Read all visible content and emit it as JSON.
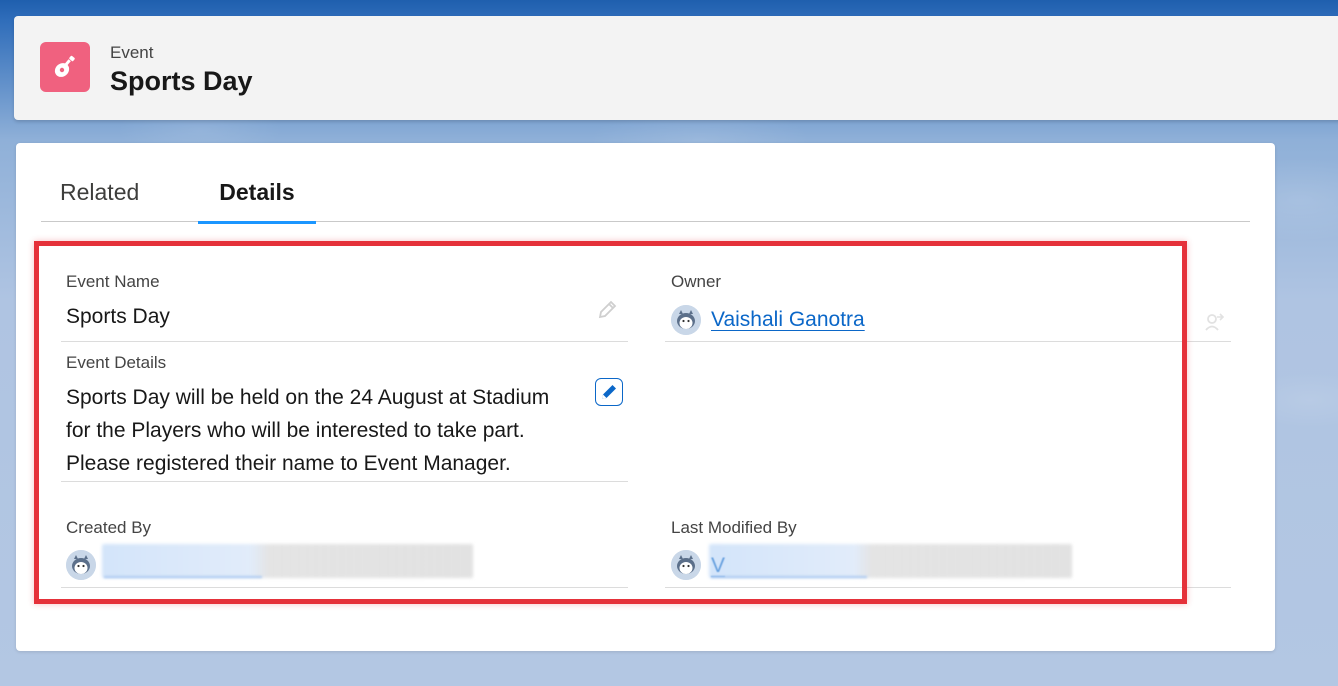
{
  "header": {
    "object_label": "Event",
    "record_title": "Sports Day",
    "icon": "guitar-icon",
    "icon_color": "#f0617f"
  },
  "tabs": [
    {
      "label": "Related",
      "active": false
    },
    {
      "label": "Details",
      "active": true
    }
  ],
  "fields": {
    "event_name": {
      "label": "Event Name",
      "value": "Sports Day"
    },
    "owner": {
      "label": "Owner",
      "value": "Vaishali Ganotra"
    },
    "event_details": {
      "label": "Event Details",
      "lines": [
        "Sports Day will be held on the 24 August at Stadium",
        "for the Players who will be interested to take part.",
        "Please registered their name to Event Manager."
      ]
    },
    "created_by": {
      "label": "Created By"
    },
    "last_modified_by": {
      "label": "Last Modified By",
      "value_initial": "V"
    }
  },
  "colors": {
    "highlight": "#e5313a",
    "link": "#0b67c8",
    "tab_active_underline": "#1b96ff"
  }
}
